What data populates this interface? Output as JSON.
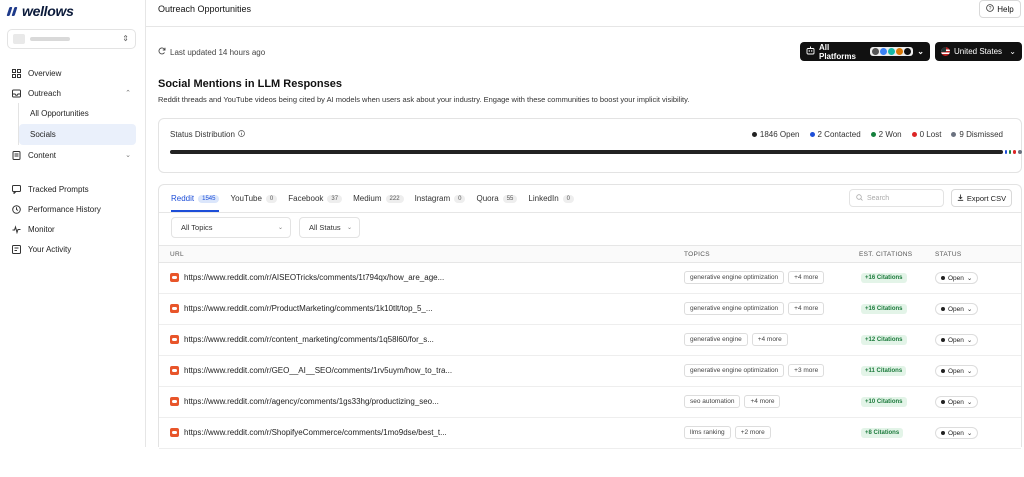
{
  "app": {
    "logo_text": "wellows"
  },
  "sidebar": {
    "workspace_chevron": "⌃⌄",
    "items": [
      {
        "label": "Overview",
        "icon": "layout-grid-icon"
      },
      {
        "label": "Outreach",
        "icon": "inbox-icon",
        "chevron": "^"
      },
      {
        "label": "Content",
        "icon": "document-icon",
        "chevron": "⌄"
      },
      {
        "label": "Tracked Prompts",
        "icon": "chat-icon"
      },
      {
        "label": "Performance History",
        "icon": "history-icon"
      },
      {
        "label": "Monitor",
        "icon": "pulse-icon"
      },
      {
        "label": "Your Activity",
        "icon": "activity-icon"
      }
    ],
    "outreach_sub": [
      {
        "label": "All Opportunities"
      },
      {
        "label": "Socials"
      }
    ]
  },
  "header": {
    "title": "Outreach Opportunities",
    "help_label": "Help"
  },
  "toolbar": {
    "updated_text": "Last updated 14 hours ago",
    "platform_label": "All Platforms",
    "country_label": "United States"
  },
  "section": {
    "title": "Social Mentions in LLM Responses",
    "description": "Reddit threads and YouTube videos being cited by AI models when users ask about your industry. Engage with these communities to boost your implicit visibility."
  },
  "status_distribution": {
    "label": "Status Distribution",
    "legend": [
      {
        "label": "1846 Open",
        "color": "#222222",
        "count": 1846
      },
      {
        "label": "2 Contacted",
        "color": "#1d4ed8",
        "count": 2
      },
      {
        "label": "2 Won",
        "color": "#15803d",
        "count": 2
      },
      {
        "label": "0 Lost",
        "color": "#dc2626",
        "count": 0
      },
      {
        "label": "9 Dismissed",
        "color": "#6b7280",
        "count": 9
      }
    ]
  },
  "tabs": [
    {
      "label": "Reddit",
      "count": "1545"
    },
    {
      "label": "YouTube",
      "count": "0"
    },
    {
      "label": "Facebook",
      "count": "37"
    },
    {
      "label": "Medium",
      "count": "222"
    },
    {
      "label": "Instagram",
      "count": "0"
    },
    {
      "label": "Quora",
      "count": "55"
    },
    {
      "label": "LinkedIn",
      "count": "0"
    }
  ],
  "search": {
    "placeholder": "Search"
  },
  "export_label": "Export CSV",
  "filters": {
    "topics": "All Topics",
    "status": "All Status"
  },
  "table": {
    "headers": {
      "url": "URL",
      "topics": "TOPICS",
      "citations": "EST. CITATIONS",
      "status": "STATUS"
    },
    "rows": [
      {
        "url": "https://www.reddit.com/r/AISEOTricks/comments/1t794qx/how_are_age...",
        "topic": "generative engine optimization",
        "more": "+4 more",
        "citations": "+16 Citations",
        "status": "Open"
      },
      {
        "url": "https://www.reddit.com/r/ProductMarketing/comments/1k10tlt/top_5_...",
        "topic": "generative engine optimization",
        "more": "+4 more",
        "citations": "+16 Citations",
        "status": "Open"
      },
      {
        "url": "https://www.reddit.com/r/content_marketing/comments/1q58l60/for_s...",
        "topic": "generative engine",
        "more": "+4 more",
        "citations": "+12 Citations",
        "status": "Open"
      },
      {
        "url": "https://www.reddit.com/r/GEO__AI__SEO/comments/1rv5uym/how_to_tra...",
        "topic": "generative engine optimization",
        "more": "+3 more",
        "citations": "+11 Citations",
        "status": "Open"
      },
      {
        "url": "https://www.reddit.com/r/agency/comments/1gs33hg/productizing_seo...",
        "topic": "seo automation",
        "more": "+4 more",
        "citations": "+10 Citations",
        "status": "Open"
      },
      {
        "url": "https://www.reddit.com/r/ShopifyeCommerce/comments/1mo9dse/best_t...",
        "topic": "llms ranking",
        "more": "+2 more",
        "citations": "+8 Citations",
        "status": "Open"
      }
    ]
  }
}
